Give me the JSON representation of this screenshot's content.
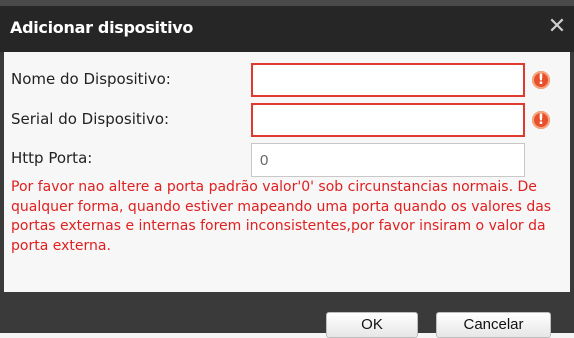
{
  "dialog": {
    "title": "Adicionar dispositivo",
    "close_glyph": "✕"
  },
  "form": {
    "name_label": "Nome do Dispositivo:",
    "name_value": "",
    "serial_label": "Serial do Dispositivo:",
    "serial_value": "",
    "port_label": "Http Porta:",
    "port_value": "0",
    "error_glyph": "!"
  },
  "warning": "Por favor nao altere a porta padrão valor'0' sob circunstancias normais. De qualquer forma, quando estiver mapeando uma porta quando os valores das portas externas e internas forem inconsistentes,por favor insiram o valor da porta externa.",
  "buttons": {
    "ok": "OK",
    "cancel": "Cancelar"
  },
  "colors": {
    "titlebar": "#262626",
    "error": "#e03a2f",
    "warning_text": "#e02020"
  },
  "icons": {
    "close": "close-icon",
    "error": "error-icon"
  }
}
